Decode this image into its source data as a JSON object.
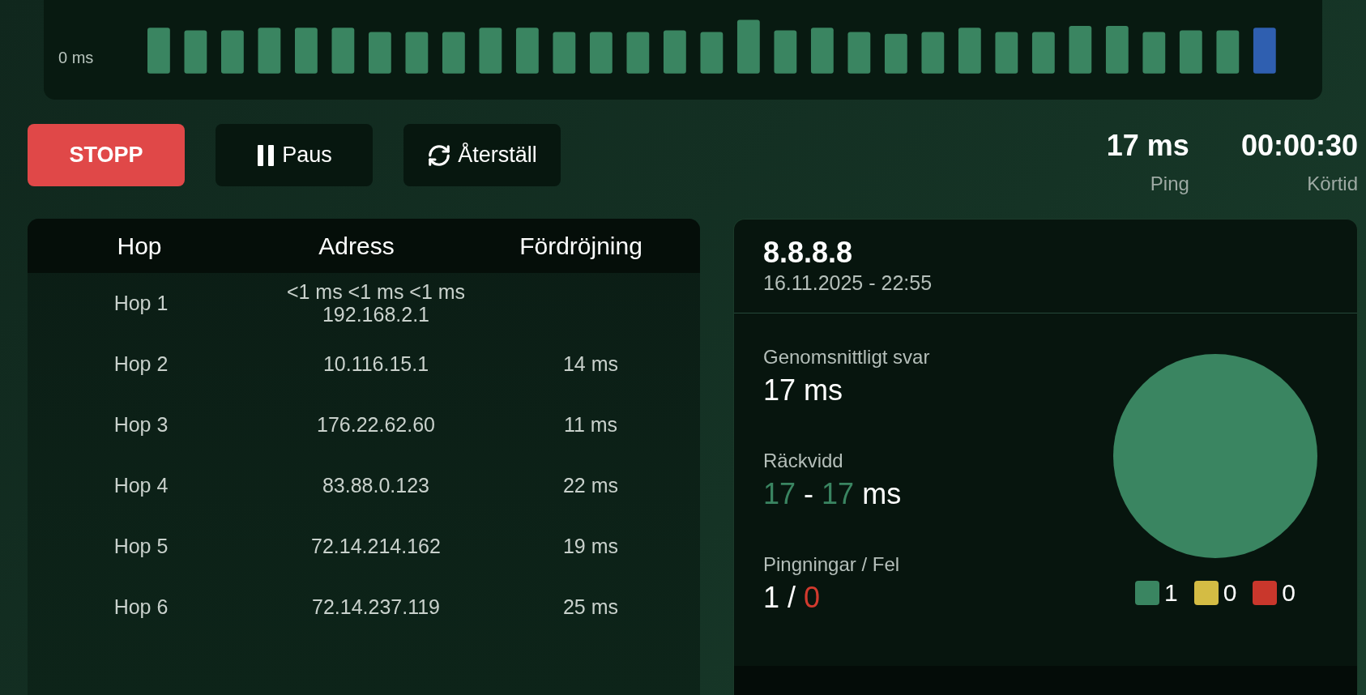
{
  "latency_strip": {
    "axis_label": "0 ms"
  },
  "buttons": [
    {
      "kind": "stop",
      "label": "STOPP"
    },
    {
      "kind": "pause",
      "label": "Paus"
    },
    {
      "kind": "reset",
      "label": "Återställ"
    }
  ],
  "stats": [
    {
      "value": "17 ms",
      "label": "Ping"
    },
    {
      "value": "00:00:30",
      "label": "Körtid"
    }
  ],
  "table": {
    "columns": [
      "Hop",
      "Adress",
      "Fördröjning"
    ],
    "rows": [
      {
        "hop": "Hop 1",
        "latencies": "<1 ms <1 ms <1 ms",
        "address": "192.168.2.1"
      },
      {
        "hop": "Hop 2",
        "address": "10.116.15.1",
        "delay": "14 ms"
      },
      {
        "hop": "Hop 3",
        "address": "176.22.62.60",
        "delay": "11 ms"
      },
      {
        "hop": "Hop 4",
        "address": "83.88.0.123",
        "delay": "22 ms"
      },
      {
        "hop": "Hop 5",
        "address": "72.14.214.162",
        "delay": "19 ms"
      },
      {
        "hop": "Hop 6",
        "address": "72.14.237.119",
        "delay": "25 ms"
      }
    ]
  },
  "summary": {
    "host": "8.8.8.8",
    "timestamp": "16.11.2025 - 22:55",
    "average": {
      "label": "Genomsnittligt svar",
      "value": "17 ms"
    },
    "range": {
      "label": "Räckvidd",
      "min": "17",
      "separator": "-",
      "max": "17",
      "unit": "ms"
    },
    "pings": {
      "label": "Pingningar / Fel",
      "sent": "1",
      "separator": "/",
      "failed": "0"
    },
    "legend": [
      {
        "count": "1",
        "color": "#3a8561"
      },
      {
        "count": "0",
        "color": "#d4bc44"
      },
      {
        "count": "0",
        "color": "#c9372c"
      }
    ]
  }
}
